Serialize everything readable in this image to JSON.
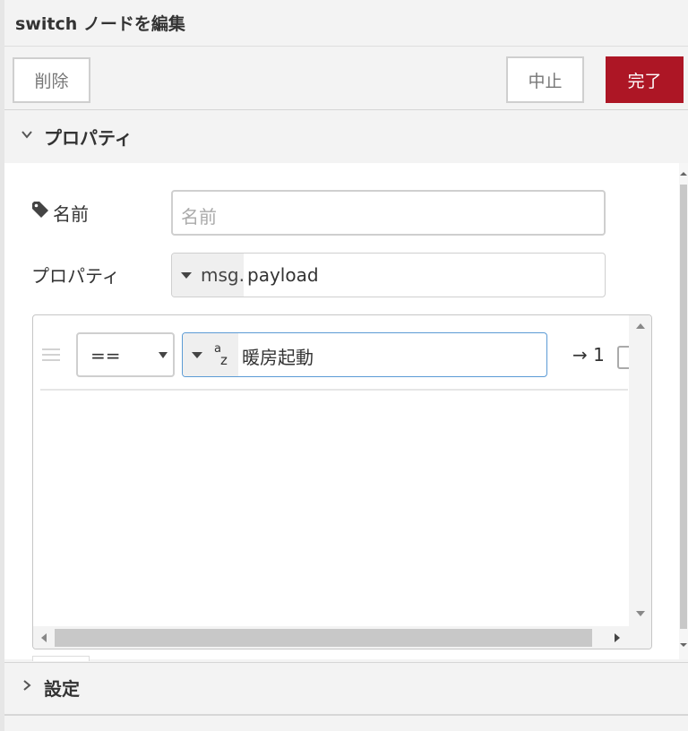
{
  "header": {
    "title": "switch ノードを編集"
  },
  "toolbar": {
    "delete_label": "削除",
    "cancel_label": "中止",
    "done_label": "完了"
  },
  "sections": {
    "properties_label": "プロパティ",
    "settings_label": "設定"
  },
  "form": {
    "name_label": "名前",
    "name_placeholder": "名前",
    "property_label": "プロパティ",
    "property_prefix": "msg.",
    "property_value": "payload"
  },
  "rule": {
    "operator": "==",
    "value_type_top": "a",
    "value_type_bottom": "z",
    "value": "暖房起動",
    "output": "→ 1"
  },
  "icons": {
    "tag": "tag-icon",
    "caret": "caret-down-icon",
    "drag": "drag-handle-icon",
    "chevron": "chevron-icon"
  },
  "colors": {
    "primary": "#ad1625",
    "focus_border": "#5b9bd5"
  }
}
